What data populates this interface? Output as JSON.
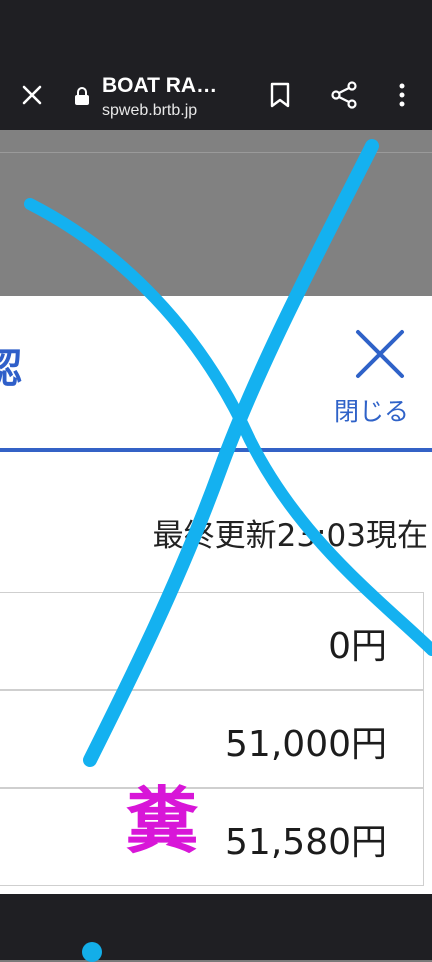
{
  "browser": {
    "page_title": "BOAT RA…",
    "host": "spweb.brtb.jp",
    "icons": {
      "close": "close-icon",
      "lock": "lock-icon",
      "bookmark": "bookmark-icon",
      "share": "share-icon",
      "more": "more-vert-icon"
    }
  },
  "sheet": {
    "title_fragment": "認",
    "close_label": "閉じる",
    "updated_text": "最終更新23:03現在",
    "rows": [
      {
        "value": "0円"
      },
      {
        "value": "51,000円"
      },
      {
        "value": "51,580円"
      }
    ]
  },
  "annotation": {
    "stamp_text": "糞"
  },
  "colors": {
    "accent_blue": "#2f62c8",
    "scribble": "#14b1f0",
    "stamp": "#d816d8",
    "chrome": "#1f1f23"
  }
}
